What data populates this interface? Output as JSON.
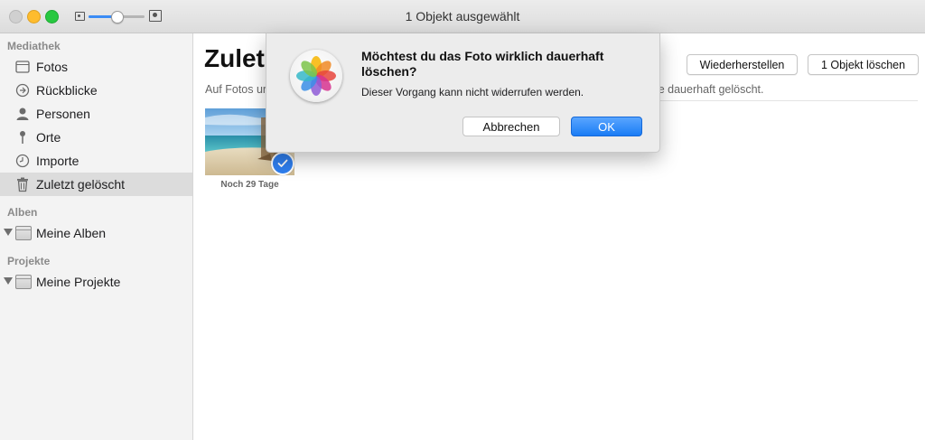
{
  "window": {
    "title": "1 Objekt ausgewählt",
    "zoom_level": 0.5
  },
  "sidebar": {
    "sections": [
      {
        "header": "Mediathek",
        "items": [
          {
            "label": "Fotos",
            "icon": "photos-grid-icon"
          },
          {
            "label": "Rückblicke",
            "icon": "memories-icon"
          },
          {
            "label": "Personen",
            "icon": "person-icon"
          },
          {
            "label": "Orte",
            "icon": "pin-icon"
          },
          {
            "label": "Importe",
            "icon": "clock-icon"
          },
          {
            "label": "Zuletzt gelöscht",
            "icon": "trash-icon",
            "selected": true
          }
        ]
      },
      {
        "header": "Alben",
        "items": [
          {
            "label": "Meine Alben",
            "icon": "folder-icon"
          }
        ]
      },
      {
        "header": "Projekte",
        "items": [
          {
            "label": "Meine Projekte",
            "icon": "folder-icon"
          }
        ]
      }
    ]
  },
  "main": {
    "title": "Zulet",
    "subtitle_start": "Auf Fotos ur",
    "subtitle_end": "kte dauerhaft gelöscht.",
    "restore_button": "Wiederherstellen",
    "delete_button": "1 Objekt löschen",
    "items": [
      {
        "caption": "Noch 29 Tage",
        "selected": true
      }
    ]
  },
  "dialog": {
    "title": "Möchtest du das Foto wirklich dauerhaft löschen?",
    "message": "Dieser Vorgang kann nicht widerrufen werden.",
    "cancel_label": "Abbrechen",
    "ok_label": "OK"
  },
  "colors": {
    "accent": "#2f7ff0",
    "sidebar_bg": "#f3f3f3",
    "selection_bg": "#dcdcdc",
    "dialog_bg": "#ececec"
  }
}
